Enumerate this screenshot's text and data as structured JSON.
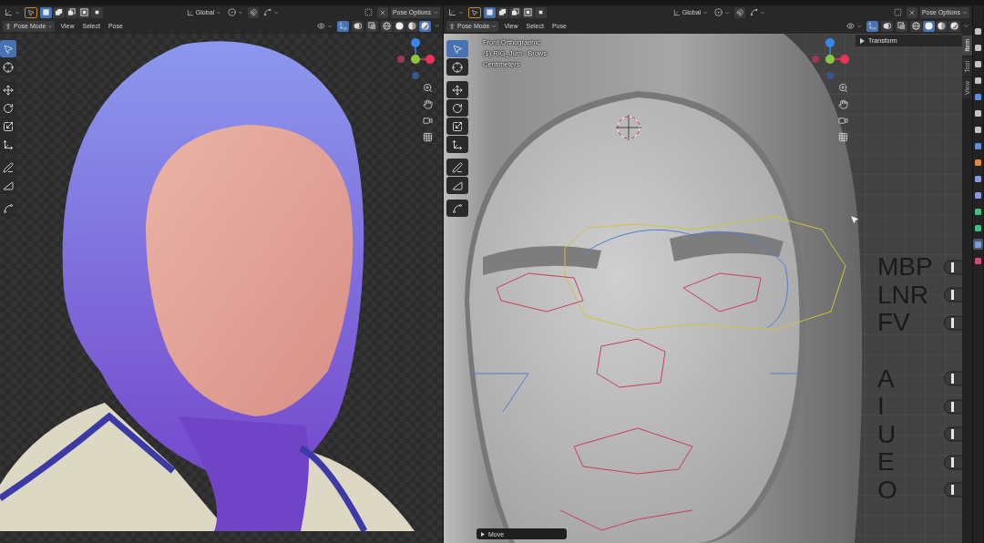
{
  "editors": [
    {
      "header": {
        "orientation": "Global",
        "options": "Pose Options",
        "mode": "Pose Mode",
        "menus": [
          "View",
          "Select",
          "Pose"
        ],
        "gizmos": true,
        "mode_buttons": [
          {
            "kind": "set",
            "selected": true
          },
          {
            "kind": "extend",
            "selected": false
          },
          {
            "kind": "subtract",
            "selected": false
          },
          {
            "kind": "invert",
            "selected": false
          },
          {
            "kind": "intersect",
            "selected": false
          }
        ],
        "shading": [
          {
            "kind": "wireframe",
            "selected": false
          },
          {
            "kind": "solid",
            "selected": false
          },
          {
            "kind": "material",
            "selected": false
          },
          {
            "kind": "rendered",
            "selected": true
          }
        ]
      },
      "viewport": {
        "kind": "render",
        "tools": [
          {
            "kind": "select",
            "selected": true
          },
          {
            "kind": "cursor",
            "selected": false
          },
          {
            "kind": "move",
            "selected": false
          },
          {
            "kind": "rotate",
            "selected": false
          },
          {
            "kind": "scale",
            "selected": false
          },
          {
            "kind": "transform",
            "selected": false
          },
          {
            "kind": "annotate",
            "selected": false
          },
          {
            "kind": "measure",
            "selected": false
          },
          {
            "kind": "roll",
            "selected": false
          }
        ]
      }
    },
    {
      "header": {
        "orientation": "Global",
        "options": "Pose Options",
        "mode": "Pose Mode",
        "menus": [
          "View",
          "Select",
          "Pose"
        ],
        "gizmos": true,
        "mode_buttons": [
          {
            "kind": "set",
            "selected": true
          },
          {
            "kind": "extend",
            "selected": false
          },
          {
            "kind": "subtract",
            "selected": false
          },
          {
            "kind": "invert",
            "selected": false
          },
          {
            "kind": "intersect",
            "selected": false
          }
        ],
        "shading": [
          {
            "kind": "wireframe",
            "selected": false
          },
          {
            "kind": "solid",
            "selected": true
          },
          {
            "kind": "material",
            "selected": false
          },
          {
            "kind": "rendered",
            "selected": false
          }
        ]
      },
      "viewport": {
        "kind": "sculpt",
        "overlay_text": [
          "Front Orthographic",
          "(1) RIG_Jum : Brows",
          "Centimeters"
        ],
        "tools": [
          {
            "kind": "select",
            "selected": true
          },
          {
            "kind": "cursor",
            "selected": false
          },
          {
            "kind": "move",
            "selected": false
          },
          {
            "kind": "rotate",
            "selected": false
          },
          {
            "kind": "scale",
            "selected": false
          },
          {
            "kind": "transform",
            "selected": false
          },
          {
            "kind": "annotate",
            "selected": false
          },
          {
            "kind": "measure",
            "selected": false
          },
          {
            "kind": "roll",
            "selected": false
          }
        ],
        "sidebar": {
          "panel": "Transform",
          "tabs": [
            {
              "label": "Item",
              "selected": true
            },
            {
              "label": "Tool",
              "selected": false
            },
            {
              "label": "View",
              "selected": false
            }
          ]
        },
        "shape_control_groups": [
          {
            "labels": [
              "MBP",
              "LNR",
              "FV"
            ]
          },
          {
            "labels": [
              "A",
              "I",
              "U",
              "E",
              "O"
            ]
          }
        ],
        "operator_panel": "Move"
      }
    }
  ],
  "property_tabs": [
    {
      "color": "#c4c4c4",
      "selected": false
    },
    {
      "color": "#c4c4c4",
      "selected": false
    },
    {
      "color": "#c4c4c4",
      "selected": false
    },
    {
      "color": "#c4c4c4",
      "selected": false
    },
    {
      "color": "#5d8ee0",
      "selected": false
    },
    {
      "color": "#c4c4c4",
      "selected": false
    },
    {
      "color": "#c4c4c4",
      "selected": false
    },
    {
      "color": "#5d8ee0",
      "selected": false
    },
    {
      "color": "#e08a40",
      "selected": false
    },
    {
      "color": "#8a9ae0",
      "selected": false
    },
    {
      "color": "#8a9ae0",
      "selected": false
    },
    {
      "color": "#40c080",
      "selected": false
    },
    {
      "color": "#40c080",
      "selected": false
    },
    {
      "color": "#7aa0d0",
      "selected": true
    },
    {
      "color": "#d04a7a",
      "selected": false
    }
  ]
}
